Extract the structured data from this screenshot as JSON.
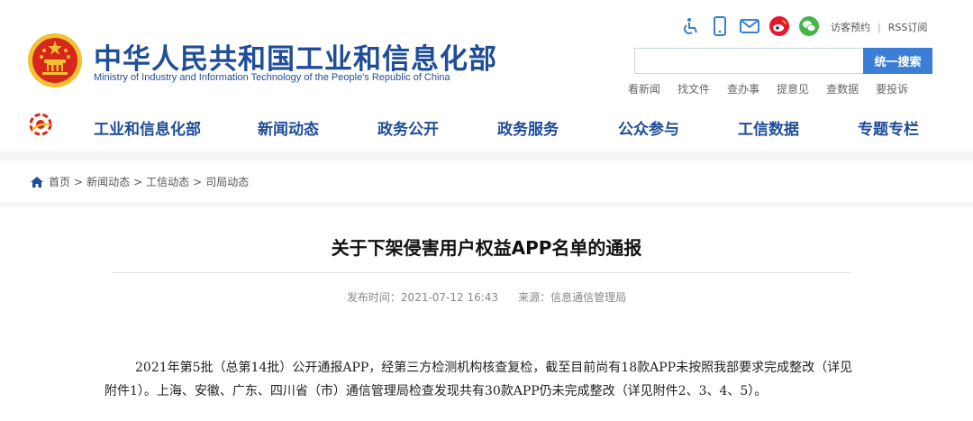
{
  "header": {
    "title": "中华人民共和国工业和信息化部",
    "subtitle": "Ministry of Industry and Information Technology of the People's Republic of China",
    "util_icons": [
      "accessibility-icon",
      "mobile-icon",
      "mail-icon",
      "weibo-icon",
      "wechat-icon"
    ],
    "links": {
      "visit": "访客预约",
      "separator": "|",
      "rss": "RSS订阅"
    },
    "search": {
      "value": "",
      "placeholder": "",
      "button": "统一搜索"
    },
    "quick_links": [
      "看新闻",
      "找文件",
      "查办事",
      "提意见",
      "查数据",
      "要投诉"
    ]
  },
  "nav": {
    "items": [
      "工业和信息化部",
      "新闻动态",
      "政务公开",
      "政务服务",
      "公众参与",
      "工信数据",
      "专题专栏"
    ]
  },
  "breadcrumb": {
    "items": [
      "首页",
      "新闻动态",
      "工信动态",
      "司局动态"
    ],
    "separator": ">"
  },
  "article": {
    "title": "关于下架侵害用户权益APP名单的通报",
    "publish_label": "发布时间：2021-07-12 16:43",
    "source_label": "来源：信息通信管理局",
    "paragraph": "2021年第5批（总第14批）公开通报APP，经第三方检测机构核查复检，截至目前尚有18款APP未按照我部要求完成整改（详见附件1）。上海、安徽、广东、四川省（市）通信管理局检查发现共有30款APP仍未完成整改（详见附件2、3、4、5）。"
  },
  "colors": {
    "brand_blue": "#1f4d98",
    "search_button": "#3a7fd5",
    "page_gray": "#f5f5f5",
    "emblem_red": "#d7261b",
    "emblem_gold": "#f2c230",
    "weibo_red": "#e6162d",
    "wechat_green": "#44b549"
  }
}
